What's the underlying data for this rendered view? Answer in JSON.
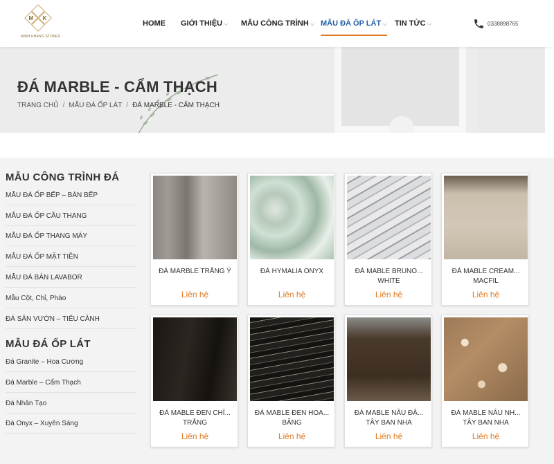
{
  "logo": {
    "letters": [
      "M",
      "K"
    ],
    "brand_text": "MINH KHANG STONES"
  },
  "nav": {
    "items": [
      {
        "label": "HOME",
        "has_dropdown": false,
        "active": false
      },
      {
        "label": "GIỚI THIỆU",
        "has_dropdown": true,
        "active": false
      },
      {
        "label": "MẪU CÔNG TRÌNH",
        "has_dropdown": true,
        "active": false
      },
      {
        "label": "MẪU ĐÁ ỐP LÁT",
        "has_dropdown": true,
        "active": true
      },
      {
        "label": "TIN TỨC",
        "has_dropdown": true,
        "active": false
      }
    ],
    "chevron": "⌵",
    "phone": "0338898765"
  },
  "banner": {
    "title": "ĐÁ MARBLE - CẨM THẠCH",
    "breadcrumb": [
      "TRANG CHỦ",
      "MẪU ĐÁ ỐP LÁT",
      "ĐÁ MARBLE - CẨM THẠCH"
    ],
    "breadcrumb_sep": "/"
  },
  "sidebar": {
    "sections": [
      {
        "heading": "MẪU CÔNG TRÌNH ĐÁ",
        "links": [
          "MẪU ĐÁ ỐP BẾP – BÀN BẾP",
          "MẪU ĐÁ ỐP CẦU THANG",
          "MẪU ĐÁ ỐP THANG MÁY",
          "MẪU ĐÁ ỐP MẶT TIỀN",
          "MẪU ĐÁ BÀN LAVABOR",
          "Mẫu Cột, Chỉ, Phào",
          "ĐÁ SÂN VƯỜN – TIỂU CẢNH"
        ]
      },
      {
        "heading": "MẪU ĐÁ ỐP LÁT",
        "links": [
          "Đá Granite – Hoa Cương",
          "Đá Marble – Cẩm Thạch",
          "Đá Nhân Tạo",
          "Đá Onyx – Xuyên Sáng"
        ]
      }
    ]
  },
  "products": [
    {
      "name": "ĐÁ MARBLE TRẮNG Ý",
      "price": "Liên hệ",
      "texture": "grey-slab"
    },
    {
      "name": "ĐÁ HYMALIA ONYX",
      "price": "Liên hệ",
      "texture": "green-onyx"
    },
    {
      "name": "ĐÁ MABLE BRUNO... WHITE",
      "price": "Liên hệ",
      "texture": "white-veined"
    },
    {
      "name": "ĐÁ MABLE CREAM... MACFIL",
      "price": "Liên hệ",
      "texture": "cream"
    },
    {
      "name": "ĐÁ MABLE ĐEN CHỈ... TRẮNG",
      "price": "Liên hệ",
      "texture": "black-white-vein"
    },
    {
      "name": "ĐÁ MABLE ĐEN HOA... BĂNG",
      "price": "Liên hệ",
      "texture": "black-streak"
    },
    {
      "name": "ĐÁ MABLE NÂU ĐẬ... TÂY BAN NHA",
      "price": "Liên hệ",
      "texture": "dark-brown"
    },
    {
      "name": "ĐÁ MABLE NÂU NH... TÂY BAN NHA",
      "price": "Liên hệ",
      "texture": "light-brown"
    }
  ],
  "colors": {
    "accent": "#e07b23",
    "active_nav": "#1f5fa8"
  }
}
